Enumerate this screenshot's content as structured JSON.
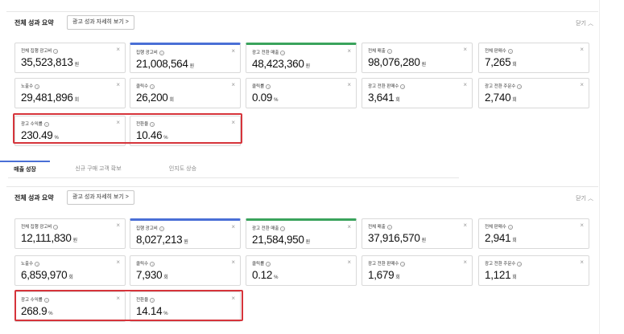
{
  "summary_top": {
    "title": "전체 성과 요약",
    "detail_button": "광고 성과 자세히 보기 >",
    "close_label": "닫기",
    "close_icon": "chevron-up-icon",
    "cards": [
      {
        "label": "전체 집행 광고비",
        "value": "35,523,813",
        "unit": "원"
      },
      {
        "label": "집행 광고비",
        "value": "21,008,564",
        "unit": "원"
      },
      {
        "label": "광고 전환 매출",
        "value": "48,423,360",
        "unit": "원"
      },
      {
        "label": "전체 매출",
        "value": "98,076,280",
        "unit": "원"
      },
      {
        "label": "전체 판매수",
        "value": "7,265",
        "unit": "회"
      },
      {
        "label": "노출수",
        "value": "29,481,896",
        "unit": "회"
      },
      {
        "label": "클릭수",
        "value": "26,200",
        "unit": "회"
      },
      {
        "label": "클릭률",
        "value": "0.09",
        "unit": "%"
      },
      {
        "label": "광고 전환 판매수",
        "value": "3,641",
        "unit": "회"
      },
      {
        "label": "광고 전환 주문수",
        "value": "2,740",
        "unit": "회"
      },
      {
        "label": "광고 수익률",
        "value": "230.49",
        "unit": "%"
      },
      {
        "label": "전환율",
        "value": "10.46",
        "unit": "%"
      }
    ]
  },
  "tabs": [
    {
      "label": "매출 성장"
    },
    {
      "label": "신규 구매 고객 확보"
    },
    {
      "label": "인지도 상승"
    }
  ],
  "summary_bottom": {
    "title": "전체 성과 요약",
    "detail_button": "광고 성과 자세히 보기 >",
    "close_label": "닫기",
    "close_icon": "chevron-up-icon",
    "cards": [
      {
        "label": "전체 집행 광고비",
        "value": "12,111,830",
        "unit": "원"
      },
      {
        "label": "집행 광고비",
        "value": "8,027,213",
        "unit": "원"
      },
      {
        "label": "광고 전환 매출",
        "value": "21,584,950",
        "unit": "원"
      },
      {
        "label": "전체 매출",
        "value": "37,916,570",
        "unit": "원"
      },
      {
        "label": "전체 판매수",
        "value": "2,941",
        "unit": "회"
      },
      {
        "label": "노출수",
        "value": "6,859,970",
        "unit": "회"
      },
      {
        "label": "클릭수",
        "value": "7,930",
        "unit": "회"
      },
      {
        "label": "클릭률",
        "value": "0.12",
        "unit": "%"
      },
      {
        "label": "광고 전환 판매수",
        "value": "1,679",
        "unit": "회"
      },
      {
        "label": "광고 전환 주문수",
        "value": "1,121",
        "unit": "회"
      },
      {
        "label": "광고 수익률",
        "value": "268.9",
        "unit": "%"
      },
      {
        "label": "전환율",
        "value": "14.14",
        "unit": "%"
      }
    ]
  },
  "colors": {
    "accent_blue": "#4a6fd6",
    "accent_green": "#3aa35c",
    "highlight_red": "#d6343b"
  }
}
